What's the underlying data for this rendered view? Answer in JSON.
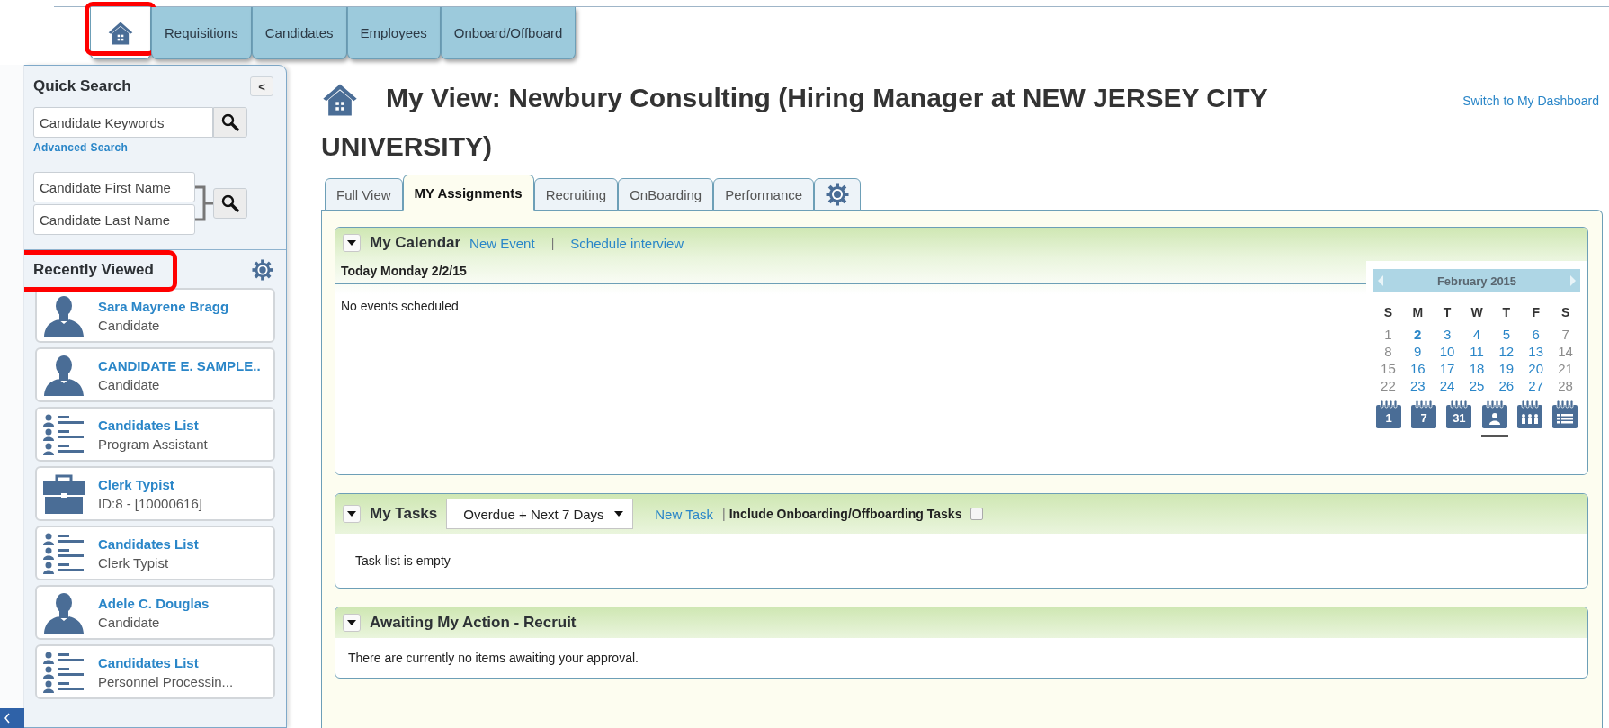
{
  "nav": {
    "tabs": [
      {
        "kind": "home",
        "selected": true,
        "highlighted": true
      },
      {
        "kind": "text",
        "label": "Requisitions",
        "selected": false
      },
      {
        "kind": "text",
        "label": "Candidates",
        "selected": false
      },
      {
        "kind": "text",
        "label": "Employees",
        "selected": false
      },
      {
        "kind": "text",
        "label": "Onboard/Offboard",
        "selected": false
      }
    ]
  },
  "sidebar": {
    "quick_search": {
      "title": "Quick Search",
      "collapse_label": "<",
      "keyword_placeholder": "Candidate Keywords",
      "advanced_link": "Advanced Search",
      "first_name_placeholder": "Candidate First Name",
      "last_name_placeholder": "Candidate Last Name"
    },
    "recently_viewed": {
      "title": "Recently Viewed",
      "highlighted": true,
      "items": [
        {
          "kind": "person",
          "name": "Sara Mayrene Bragg",
          "detail": "Candidate"
        },
        {
          "kind": "person",
          "name": "CANDIDATE E. SAMPLE..",
          "detail": "Candidate"
        },
        {
          "kind": "list",
          "name": "Candidates List",
          "detail": "Program Assistant"
        },
        {
          "kind": "job",
          "name": "Clerk Typist",
          "detail": "ID:8 - [10000616]"
        },
        {
          "kind": "list",
          "name": "Candidates List",
          "detail": "Clerk Typist"
        },
        {
          "kind": "person",
          "name": "Adele C. Douglas",
          "detail": "Candidate"
        },
        {
          "kind": "list",
          "name": "Candidates List",
          "detail": "Personnel Processin..."
        }
      ]
    }
  },
  "main": {
    "title_line_1": "My View: Newbury Consulting (Hiring Manager at NEW JERSEY CITY",
    "title_line_2": "UNIVERSITY)",
    "switch_link": "Switch to My Dashboard",
    "tabs": [
      {
        "kind": "text",
        "label": "Full View",
        "selected": false
      },
      {
        "kind": "text",
        "label": "MY Assignments",
        "selected": true
      },
      {
        "kind": "text",
        "label": "Recruiting",
        "selected": false
      },
      {
        "kind": "text",
        "label": "OnBoarding",
        "selected": false
      },
      {
        "kind": "text",
        "label": "Performance",
        "selected": false
      },
      {
        "kind": "settings",
        "selected": false
      }
    ],
    "calendar": {
      "title": "My Calendar",
      "expanded": true,
      "links": [
        "New Event",
        "Schedule interview"
      ],
      "separator": "|",
      "today": "Today Monday 2/2/15",
      "empty": "No events scheduled",
      "month": "February 2015",
      "weekdays": [
        "S",
        "M",
        "T",
        "W",
        "T",
        "F",
        "S"
      ],
      "weeks": [
        [
          {
            "label": "1",
            "kind": "weekend"
          },
          {
            "label": "2",
            "kind": "today"
          },
          {
            "label": "3",
            "kind": "weekday"
          },
          {
            "label": "4",
            "kind": "weekday"
          },
          {
            "label": "5",
            "kind": "weekday"
          },
          {
            "label": "6",
            "kind": "weekday"
          },
          {
            "label": "7",
            "kind": "weekend"
          }
        ],
        [
          {
            "label": "8",
            "kind": "weekend"
          },
          {
            "label": "9",
            "kind": "weekday"
          },
          {
            "label": "10",
            "kind": "weekday"
          },
          {
            "label": "11",
            "kind": "weekday"
          },
          {
            "label": "12",
            "kind": "weekday"
          },
          {
            "label": "13",
            "kind": "weekday"
          },
          {
            "label": "14",
            "kind": "weekend"
          }
        ],
        [
          {
            "label": "15",
            "kind": "weekend"
          },
          {
            "label": "16",
            "kind": "weekday"
          },
          {
            "label": "17",
            "kind": "weekday"
          },
          {
            "label": "18",
            "kind": "weekday"
          },
          {
            "label": "19",
            "kind": "weekday"
          },
          {
            "label": "20",
            "kind": "weekday"
          },
          {
            "label": "21",
            "kind": "weekend"
          }
        ],
        [
          {
            "label": "22",
            "kind": "weekend"
          },
          {
            "label": "23",
            "kind": "weekday"
          },
          {
            "label": "24",
            "kind": "weekday"
          },
          {
            "label": "25",
            "kind": "weekday"
          },
          {
            "label": "26",
            "kind": "weekday"
          },
          {
            "label": "27",
            "kind": "weekday"
          },
          {
            "label": "28",
            "kind": "weekend"
          }
        ]
      ],
      "views": [
        {
          "kind": "number",
          "label": "1",
          "selected": false
        },
        {
          "kind": "number",
          "label": "7",
          "selected": false
        },
        {
          "kind": "number",
          "label": "31",
          "selected": false
        },
        {
          "kind": "person",
          "selected": true
        },
        {
          "kind": "group",
          "selected": false
        },
        {
          "kind": "list",
          "selected": false
        }
      ]
    },
    "tasks": {
      "title": "My Tasks",
      "expanded": true,
      "filter": "Overdue + Next 7 Days",
      "new_task": "New Task",
      "separator": "|",
      "include_label": "Include Onboarding/Offboarding Tasks",
      "include_checked": false,
      "empty": "Task list is empty"
    },
    "awaiting": {
      "title": "Awaiting My Action - Recruit",
      "expanded": true,
      "text": "There are currently no items awaiting your approval."
    }
  }
}
